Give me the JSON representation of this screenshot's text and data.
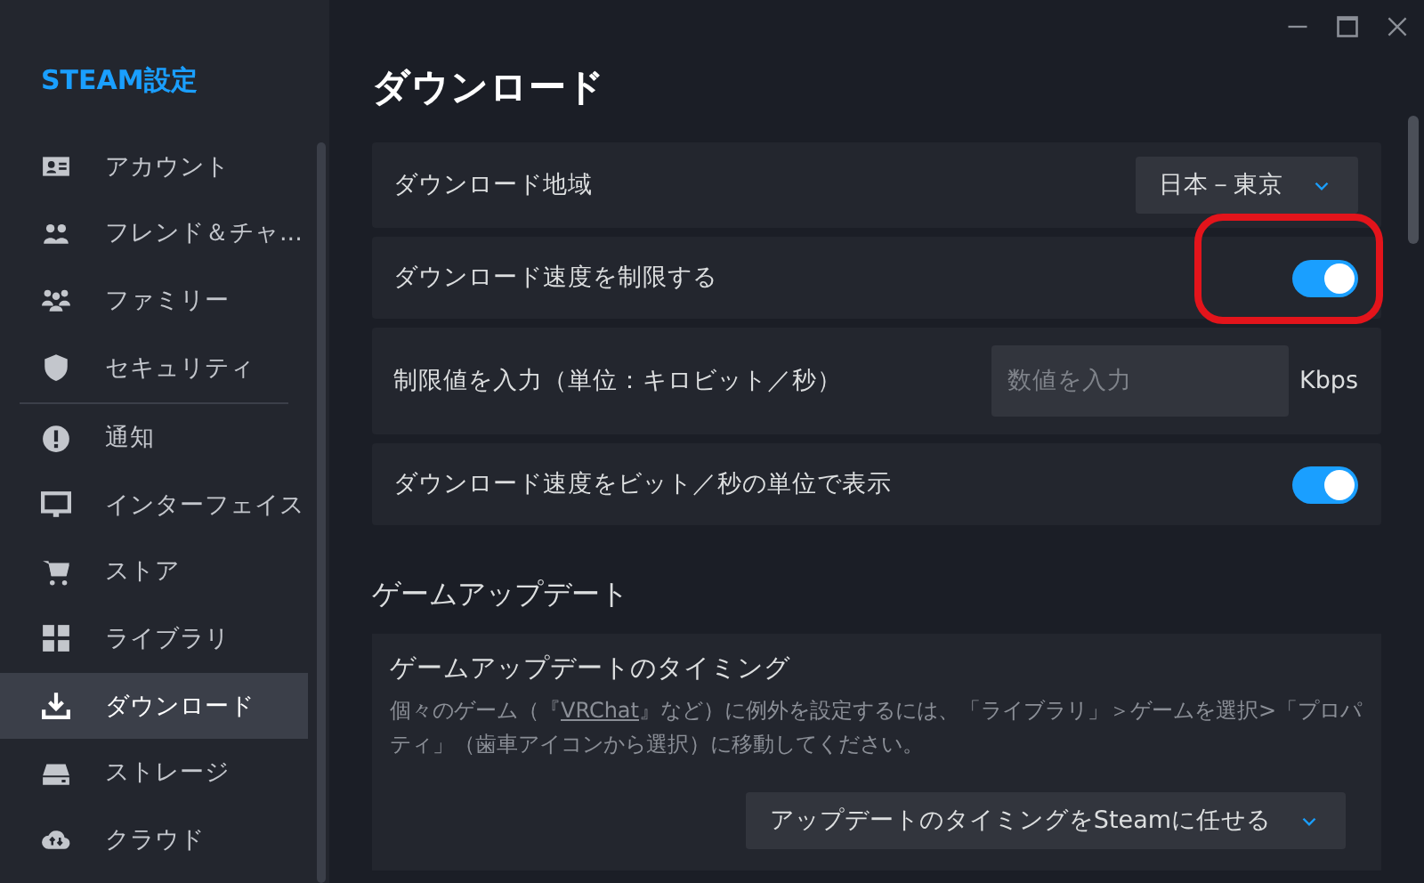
{
  "sidebar": {
    "title": "STEAM設定",
    "groups": [
      {
        "items": [
          {
            "label": "アカウント",
            "selected": false
          },
          {
            "label": "フレンド＆チャ...",
            "selected": false
          },
          {
            "label": "ファミリー",
            "selected": false
          },
          {
            "label": "セキュリティ",
            "selected": false
          }
        ]
      },
      {
        "items": [
          {
            "label": "通知",
            "selected": false
          },
          {
            "label": "インターフェイス",
            "selected": false
          },
          {
            "label": "ストア",
            "selected": false
          },
          {
            "label": "ライブラリ",
            "selected": false
          },
          {
            "label": "ダウンロード",
            "selected": true
          },
          {
            "label": "ストレージ",
            "selected": false
          },
          {
            "label": "クラウド",
            "selected": false
          }
        ]
      }
    ]
  },
  "page": {
    "title": "ダウンロード",
    "rows": [
      {
        "kind": "dropdown",
        "label": "ダウンロード地域",
        "value": "日本－東京"
      },
      {
        "kind": "toggle",
        "label": "ダウンロード速度を制限する",
        "on": true,
        "highlighted": true
      },
      {
        "kind": "input",
        "label": "制限値を入力（単位：キロビット／秒）",
        "placeholder": "数値を入力",
        "unit": "Kbps"
      },
      {
        "kind": "toggle",
        "label": "ダウンロード速度をビット／秒の単位で表示",
        "on": true,
        "highlighted": false
      }
    ],
    "section": {
      "title": "ゲームアップデート",
      "card": {
        "title": "ゲームアップデートのタイミング",
        "description_before": "個々のゲーム（『",
        "description_link": "VRChat",
        "description_after": "』など）に例外を設定するには、「ライブラリ」＞ゲームを選択>「プロパティ」（歯車アイコンから選択）に移動してください。",
        "dropdown": "アップデートのタイミングをSteamに任せる"
      }
    }
  }
}
